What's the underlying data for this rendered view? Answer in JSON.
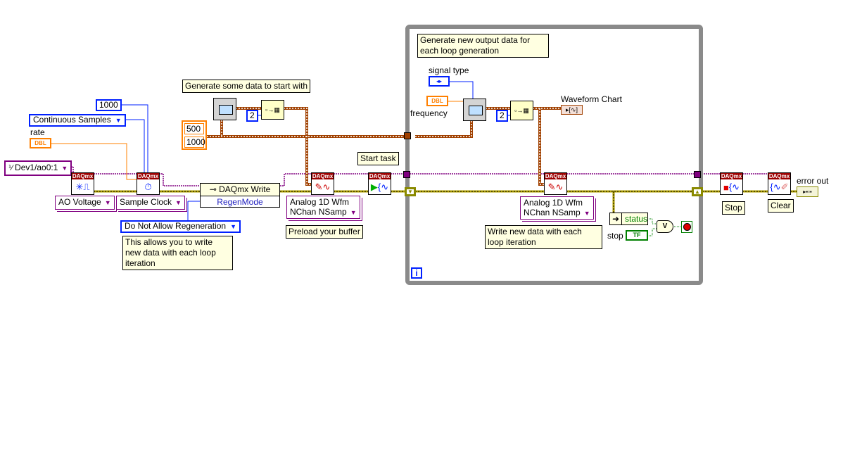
{
  "setup": {
    "samples_const": "1000",
    "sample_mode": "Continuous Samples",
    "rate_label": "rate",
    "rate_type": "DBL",
    "channel": "Dev1/ao0:1",
    "channel_type": "AO Voltage",
    "timing_type": "Sample Clock",
    "daqmx_badge": "DAQmx"
  },
  "property_node": {
    "title": "DAQmx Write",
    "property": "RegenMode",
    "value": "Do Not Allow Regeneration",
    "comment": "This allows you to write new data with each loop iteration"
  },
  "initial_data": {
    "comment": "Generate some data to start with",
    "array": [
      "500",
      "1000"
    ],
    "build_count": "2"
  },
  "preload": {
    "write_mode": [
      "Analog 1D Wfm",
      "NChan NSamp"
    ],
    "comment": "Preload your buffer"
  },
  "start": {
    "comment": "Start task"
  },
  "loop": {
    "comment": "Generate new output data for each loop generation",
    "signal_type_label": "signal type",
    "frequency_label": "frequency",
    "frequency_type": "DBL",
    "build_count": "2",
    "chart_label": "Waveform Chart",
    "write_mode": [
      "Analog 1D Wfm",
      "NChan NSamp"
    ],
    "write_comment": "Write new data with each loop iteration",
    "status_label": "status",
    "stop_label": "stop",
    "stop_type": "TF",
    "or_symbol": "V",
    "iteration": "i"
  },
  "finish": {
    "stop_label": "Stop",
    "clear_label": "Clear",
    "error_out_label": "error out"
  },
  "colors": {
    "task_wire": "#800080",
    "error_wire": "#b0a000",
    "waveform_wire": "#a04000",
    "numeric_const": "#0020ff",
    "dbl": "#ff8000",
    "boolean": "#008000",
    "loop_border": "#8a8a8a",
    "comment_bg": "#ffffe1"
  }
}
